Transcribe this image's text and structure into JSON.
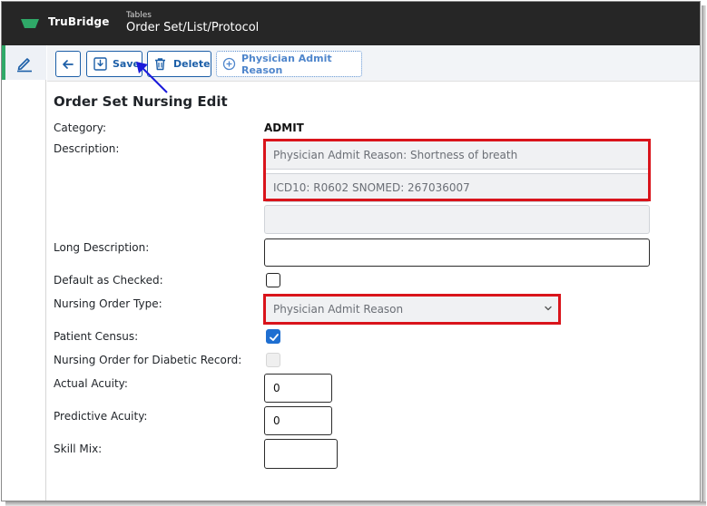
{
  "app": {
    "brand": "TruBridge",
    "breadcrumb_small": "Tables",
    "breadcrumb_title": "Order Set/List/Protocol",
    "brand_color": "#2fa968"
  },
  "sidebar": {
    "items": [
      {
        "icon": "pencil-icon",
        "active": true
      }
    ]
  },
  "toolbar": {
    "back_icon": "arrow-left-icon",
    "save_label": "Save",
    "delete_label": "Delete",
    "physician_label": "Physician Admit Reason"
  },
  "form": {
    "title": "Order Set Nursing Edit",
    "category_label": "Category:",
    "category_value": "ADMIT",
    "description_label": "Description:",
    "description_line1": "Physician Admit Reason: Shortness of breath",
    "description_line2": "ICD10: R0602  SNOMED: 267036007",
    "description_line3": "",
    "long_description_label": "Long Description:",
    "long_description_value": "",
    "default_checked_label": "Default as Checked:",
    "default_checked": false,
    "nursing_order_type_label": "Nursing Order Type:",
    "nursing_order_type_value": "Physician Admit Reason",
    "patient_census_label": "Patient Census:",
    "patient_census": true,
    "diabetic_record_label": "Nursing Order for Diabetic Record:",
    "diabetic_record": false,
    "actual_acuity_label": "Actual Acuity:",
    "actual_acuity_value": "0",
    "predictive_acuity_label": "Predictive Acuity:",
    "predictive_acuity_value": "0",
    "skill_mix_label": "Skill Mix:",
    "skill_mix_value": ""
  },
  "annotation": {
    "highlight_color": "#d9141b",
    "arrow_color": "#1a1adb"
  }
}
